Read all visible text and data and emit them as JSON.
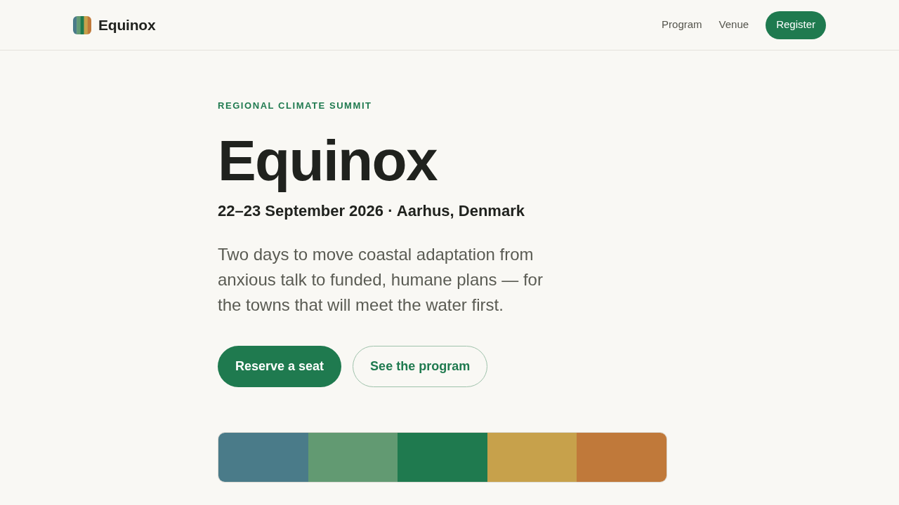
{
  "header": {
    "brand": "Equinox",
    "nav": [
      {
        "label": "Program",
        "kind": "link"
      },
      {
        "label": "Venue",
        "kind": "link"
      },
      {
        "label": "Register",
        "kind": "button"
      }
    ]
  },
  "hero": {
    "eyebrow": "REGIONAL CLIMATE SUMMIT",
    "title": "Equinox",
    "meta": "22–23 September 2026 · Aarhus, Denmark",
    "lead": "Two days to move coastal adaptation from anxious talk to funded, humane plans — for the towns that will meet the water first.",
    "actions": [
      {
        "label": "Reserve a seat",
        "kind": "primary"
      },
      {
        "label": "See the program",
        "kind": "secondary"
      }
    ]
  },
  "palette": [
    {
      "color": "#4a7b89"
    },
    {
      "color": "#629a72"
    },
    {
      "color": "#1f7a4f"
    },
    {
      "color": "#c7a14b"
    },
    {
      "color": "#c0793a"
    }
  ]
}
